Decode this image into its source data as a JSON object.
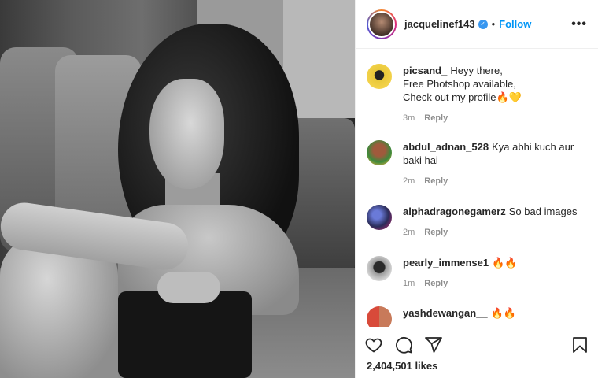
{
  "post": {
    "image_alt": "photo",
    "account": {
      "username": "jacquelinef143",
      "verified_icon": "verified-badge-icon",
      "dot": "•",
      "follow_label": "Follow",
      "more_icon": "more-options-icon",
      "more_label": "•••"
    },
    "comments": [
      {
        "username": "picsand_",
        "text_lines": [
          "Heyy there,",
          "Free Photshop available,",
          "Check out my profile🔥💛"
        ],
        "time": "3m",
        "reply_label": "Reply"
      },
      {
        "username": "abdul_adnan_528",
        "text_lines": [
          "Kya abhi kuch aur",
          "baki hai"
        ],
        "time": "2m",
        "reply_label": "Reply"
      },
      {
        "username": "alphadragonegamerz",
        "text_lines": [
          "So bad images"
        ],
        "time": "2m",
        "reply_label": "Reply"
      },
      {
        "username": "pearly_immense1",
        "text_lines": [
          "🔥🔥"
        ],
        "time": "1m",
        "reply_label": "Reply"
      },
      {
        "username": "yashdewangan__",
        "text_lines": [
          "🔥🔥"
        ],
        "time": "",
        "reply_label": ""
      }
    ],
    "actions": {
      "like_icon": "heart-icon",
      "comment_icon": "comment-icon",
      "share_icon": "send-icon",
      "save_icon": "bookmark-icon"
    },
    "likes": "2,404,501 likes"
  }
}
